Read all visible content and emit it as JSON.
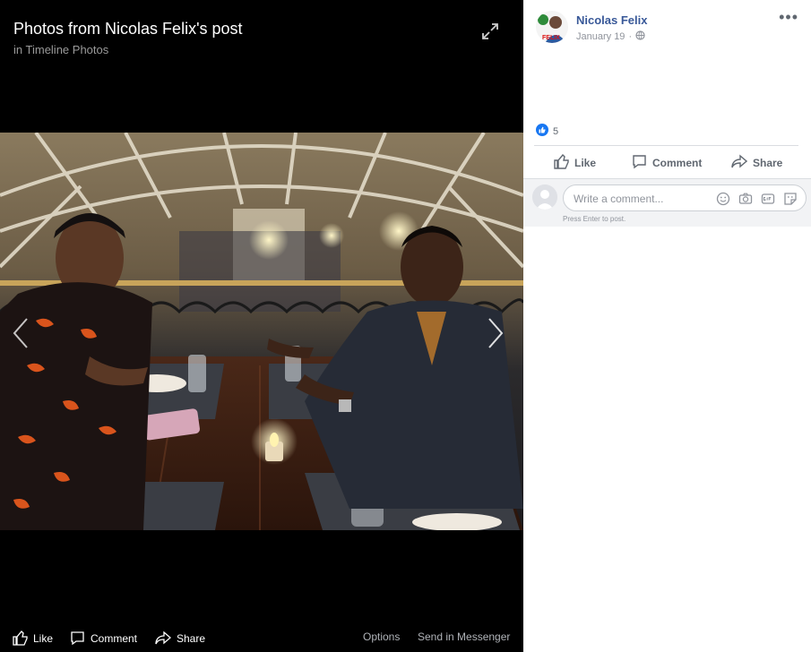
{
  "viewer": {
    "title": "Photos from Nicolas Felix's post",
    "subtitle_prefix": "in",
    "subtitle_link": "Timeline Photos",
    "actions": {
      "like": "Like",
      "comment": "Comment",
      "share": "Share",
      "options": "Options",
      "send": "Send in Messenger"
    }
  },
  "post": {
    "author": "Nicolas Felix",
    "avatar_text": "FELIX",
    "date": "January 19",
    "privacy_icon": "globe-icon",
    "reaction_count": "5",
    "actions": {
      "like": "Like",
      "comment": "Comment",
      "share": "Share"
    }
  },
  "comment": {
    "placeholder": "Write a comment...",
    "hint": "Press Enter to post."
  },
  "colors": {
    "link": "#385898",
    "like_blue": "#1877f2",
    "panel_bg": "#ffffff",
    "viewer_bg": "#000000"
  }
}
